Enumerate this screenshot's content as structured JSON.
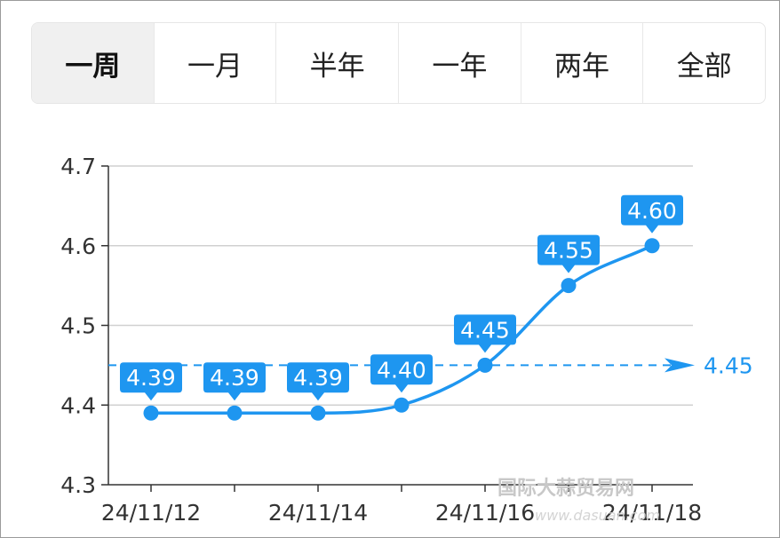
{
  "tabs": [
    {
      "label": "一周",
      "active": true
    },
    {
      "label": "一月",
      "active": false
    },
    {
      "label": "半年",
      "active": false
    },
    {
      "label": "一年",
      "active": false
    },
    {
      "label": "两年",
      "active": false
    },
    {
      "label": "全部",
      "active": false
    }
  ],
  "watermark": {
    "text": "国际大蒜贸易网",
    "sub": "www.dasuan.com"
  },
  "colors": {
    "series": "#1e96f0",
    "grid": "#d0d0d0",
    "axis": "#333333",
    "text": "#333333"
  },
  "chart_data": {
    "type": "line",
    "x": [
      "24/11/12",
      "24/11/13",
      "24/11/14",
      "24/11/15",
      "24/11/16",
      "24/11/17",
      "24/11/18"
    ],
    "x_tick_labels": [
      "24/11/12",
      "",
      "24/11/14",
      "",
      "24/11/16",
      "",
      "24/11/18"
    ],
    "series": [
      {
        "values": [
          4.39,
          4.39,
          4.39,
          4.4,
          4.45,
          4.55,
          4.6
        ],
        "labels": [
          "4.39",
          "4.39",
          "4.39",
          "4.40",
          "4.45",
          "4.55",
          "4.60"
        ]
      }
    ],
    "ylim": [
      4.3,
      4.7
    ],
    "y_ticks": [
      "4.3",
      "4.4",
      "4.5",
      "4.6",
      "4.7"
    ],
    "grid": true,
    "average_line": {
      "value": 4.45,
      "label": "4.45"
    },
    "title": "",
    "xlabel": "",
    "ylabel": ""
  }
}
